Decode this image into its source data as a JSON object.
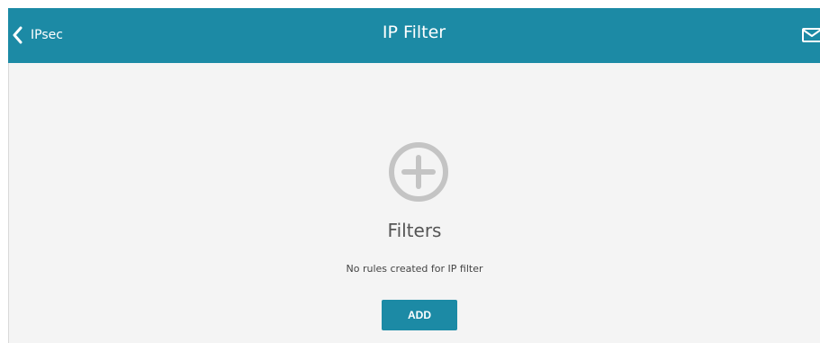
{
  "header": {
    "back_label": "IPsec",
    "title": "IP Filter",
    "back_icon": "chevron-left-icon",
    "mail_icon": "envelope-icon",
    "background_color": "#1c8aa5"
  },
  "main": {
    "add_icon": "plus-circle-icon",
    "heading": "Filters",
    "empty_message": "No rules created for IP filter",
    "add_button_label": "ADD",
    "background_color": "#f4f4f4"
  }
}
